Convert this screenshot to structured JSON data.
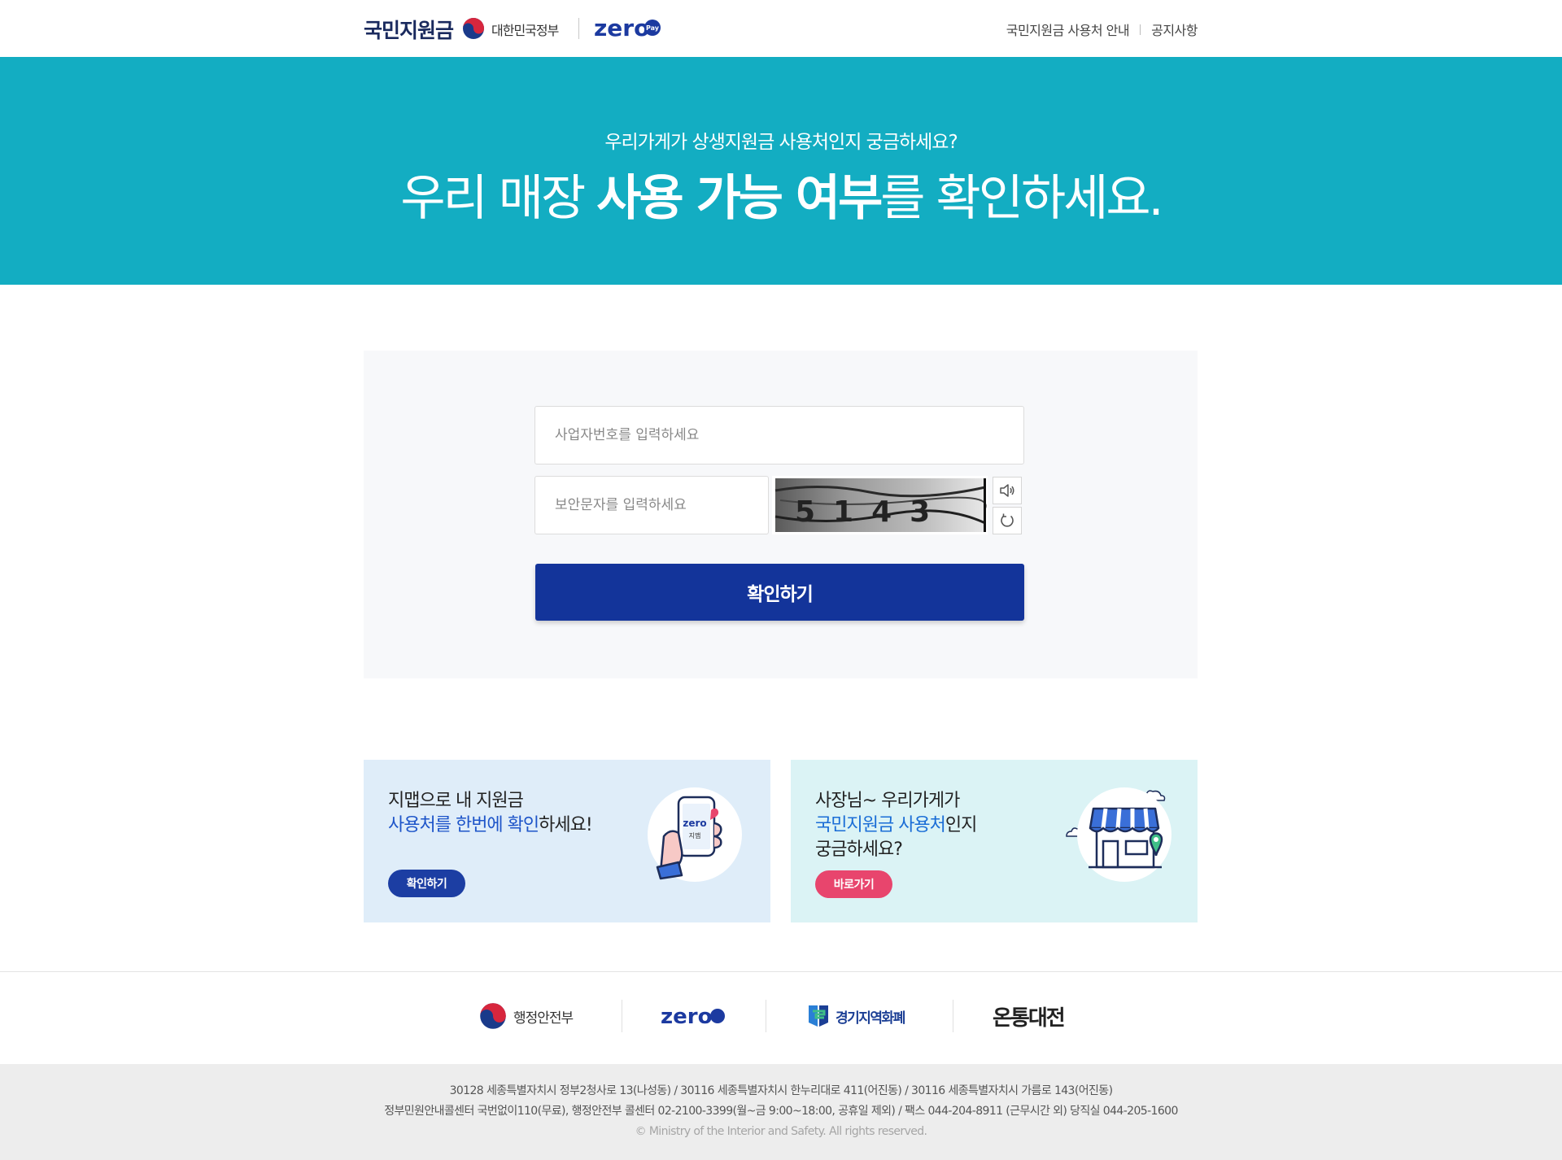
{
  "header": {
    "logo_text": "국민지원금",
    "gov_label": "대한민국정부",
    "zero_label": "zero",
    "pay_label": "Pay",
    "nav": [
      {
        "label": "국민지원금 사용처 안내"
      },
      {
        "label": "공지사항"
      }
    ]
  },
  "hero": {
    "subtitle": "우리가게가 상생지원금 사용처인지 궁금하세요?",
    "title_pre": "우리 매장 ",
    "title_bold": "사용 가능 여부",
    "title_post": "를 확인하세요."
  },
  "form": {
    "business_placeholder": "사업자번호를 입력하세요",
    "captcha_placeholder": "보안문자를 입력하세요",
    "captcha_chars": "5143",
    "submit_label": "확인하기"
  },
  "banners": {
    "left": {
      "line1": "지맵으로 내 지원금",
      "line2_hl": "사용처를 한번에 확인",
      "line2_rest": "하세요!",
      "button": "확인하기",
      "phone_text": "zero",
      "phone_sub": "지맵"
    },
    "right": {
      "line1": "사장님~ 우리가게가",
      "line2_hl": "국민지원금 사용처",
      "line2_rest": "인지",
      "line3": "궁금하세요?",
      "button": "바로가기"
    }
  },
  "partners": [
    {
      "label": "행정안전부"
    },
    {
      "label": "zero"
    },
    {
      "label": "경기지역화폐"
    },
    {
      "label": "온통대전"
    }
  ],
  "footer": {
    "line1": "30128 세종특별자치시 정부2청사로 13(나성동) / 30116 세종특별자치시 한누리대로 411(어진동) / 30116 세종특별자치시 가름로 143(어진동)",
    "line2": "정부민원안내콜센터 국번없이110(무료), 행정안전부 콜센터 02-2100-3399(월~금 9:00~18:00, 공휴일 제외) / 팩스 044-204-8911 (근무시간 외) 당직실 044-205-1600",
    "copyright": "© Ministry of the Interior and Safety. All rights reserved."
  },
  "colors": {
    "hero_bg": "#13adc2",
    "primary_button": "#13349a",
    "banner_left_bg": "#dfedf9",
    "banner_right_bg": "#dbf3f5",
    "pink_button": "#e8456d",
    "footer_bg": "#ededed"
  }
}
